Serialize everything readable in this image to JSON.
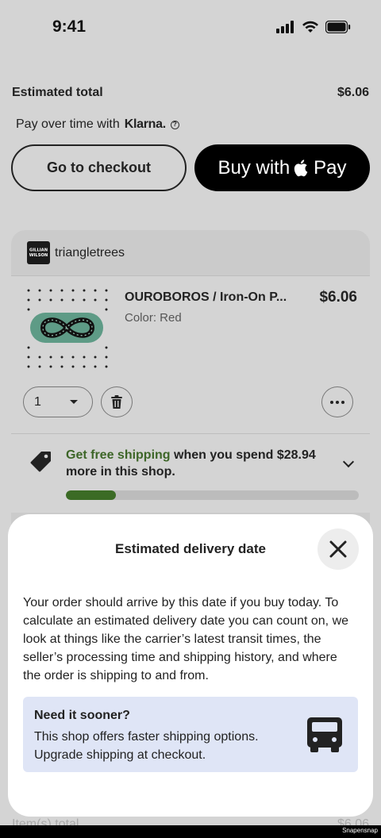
{
  "status_bar": {
    "time": "9:41"
  },
  "summary": {
    "total_label": "Estimated total",
    "total_value": "$6.06",
    "klarna_prefix": "Pay over time with",
    "klarna_brand": "Klarna.",
    "klarna_info": "?"
  },
  "actions": {
    "checkout_label": "Go to checkout",
    "applepay_prefix": "Buy with",
    "applepay_suffix": "Pay"
  },
  "shop": {
    "avatar_text": "GILLIAN WILSON",
    "name": "triangletrees",
    "item": {
      "title": "OUROBOROS / Iron-On P...",
      "price": "$6.06",
      "color_label": "Color: Red",
      "quantity": "1"
    },
    "shipping": {
      "highlight": "Get free shipping",
      "rest": " when you spend $28.94 more in this shop.",
      "progress": 0.17,
      "accent": "#3b6b25"
    }
  },
  "below": {
    "label": "Item(s) total",
    "value": "$6.06"
  },
  "sheet": {
    "title": "Estimated delivery date",
    "body": "Your order should arrive by this date if you buy today. To calculate an estimated delivery date you can count on, we look at things like the carrier’s latest transit times, the seller’s processing time and shipping history, and where the order is shipping to and from.",
    "sooner_title": "Need it sooner?",
    "sooner_text": "This shop offers faster shipping options. Upgrade shipping at checkout.",
    "icons": {
      "close": "close-icon",
      "truck": "truck-icon"
    }
  },
  "watermark": "Snapensnap"
}
